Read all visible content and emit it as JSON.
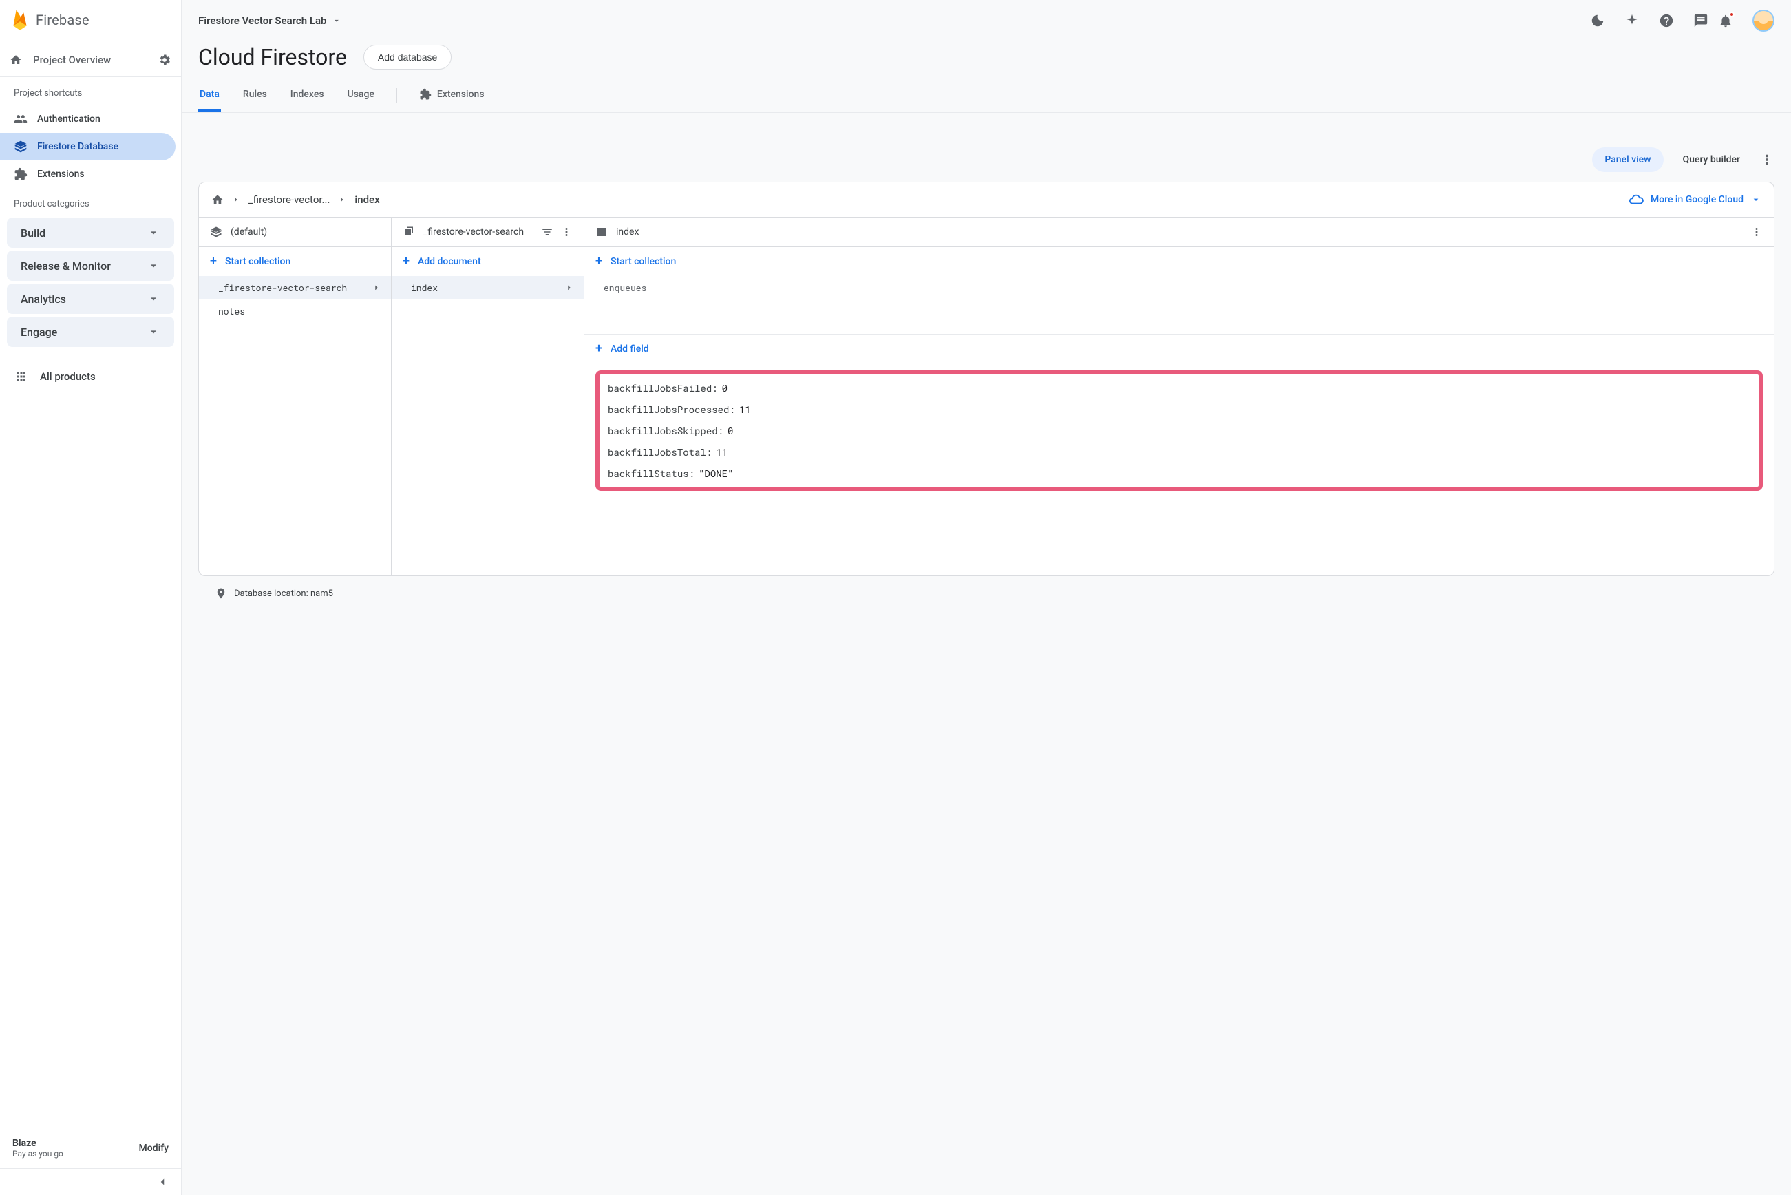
{
  "brand": "Firebase",
  "project_selector": "Firestore Vector Search Lab",
  "topbar_icons": [
    "moon",
    "sparkle",
    "help",
    "chat",
    "bell"
  ],
  "sidebar": {
    "overview": "Project Overview",
    "shortcuts_label": "Project shortcuts",
    "shortcuts": [
      {
        "label": "Authentication",
        "icon": "people"
      },
      {
        "label": "Firestore Database",
        "icon": "stack",
        "active": true
      },
      {
        "label": "Extensions",
        "icon": "puzzle"
      }
    ],
    "categories_label": "Product categories",
    "categories": [
      "Build",
      "Release & Monitor",
      "Analytics",
      "Engage"
    ],
    "all_products": "All products",
    "plan": {
      "name": "Blaze",
      "sub": "Pay as you go",
      "modify": "Modify"
    }
  },
  "page": {
    "title": "Cloud Firestore",
    "add_db": "Add database",
    "tabs": [
      "Data",
      "Rules",
      "Indexes",
      "Usage"
    ],
    "tab_ext": "Extensions",
    "active_tab": "Data"
  },
  "toolbar": {
    "panel_view": "Panel view",
    "query_builder": "Query builder"
  },
  "breadcrumb": {
    "parts": [
      "_firestore-vector...",
      "index"
    ],
    "cloud_link": "More in Google Cloud"
  },
  "col1": {
    "header": "(default)",
    "action": "Start collection",
    "items": [
      {
        "label": "_firestore-vector-search",
        "selected": true
      },
      {
        "label": "notes"
      }
    ]
  },
  "col2": {
    "header": "_firestore-vector-search",
    "action": "Add document",
    "items": [
      {
        "label": "index",
        "selected": true
      }
    ]
  },
  "col3": {
    "header": "index",
    "action1": "Start collection",
    "subcollections": [
      "enqueues"
    ],
    "action2": "Add field",
    "fields": [
      {
        "name": "backfillJobsFailed",
        "value": "0"
      },
      {
        "name": "backfillJobsProcessed",
        "value": "11"
      },
      {
        "name": "backfillJobsSkipped",
        "value": "0"
      },
      {
        "name": "backfillJobsTotal",
        "value": "11"
      },
      {
        "name": "backfillStatus",
        "value": "\"DONE\""
      }
    ]
  },
  "footer": {
    "location_label": "Database location: nam5"
  }
}
